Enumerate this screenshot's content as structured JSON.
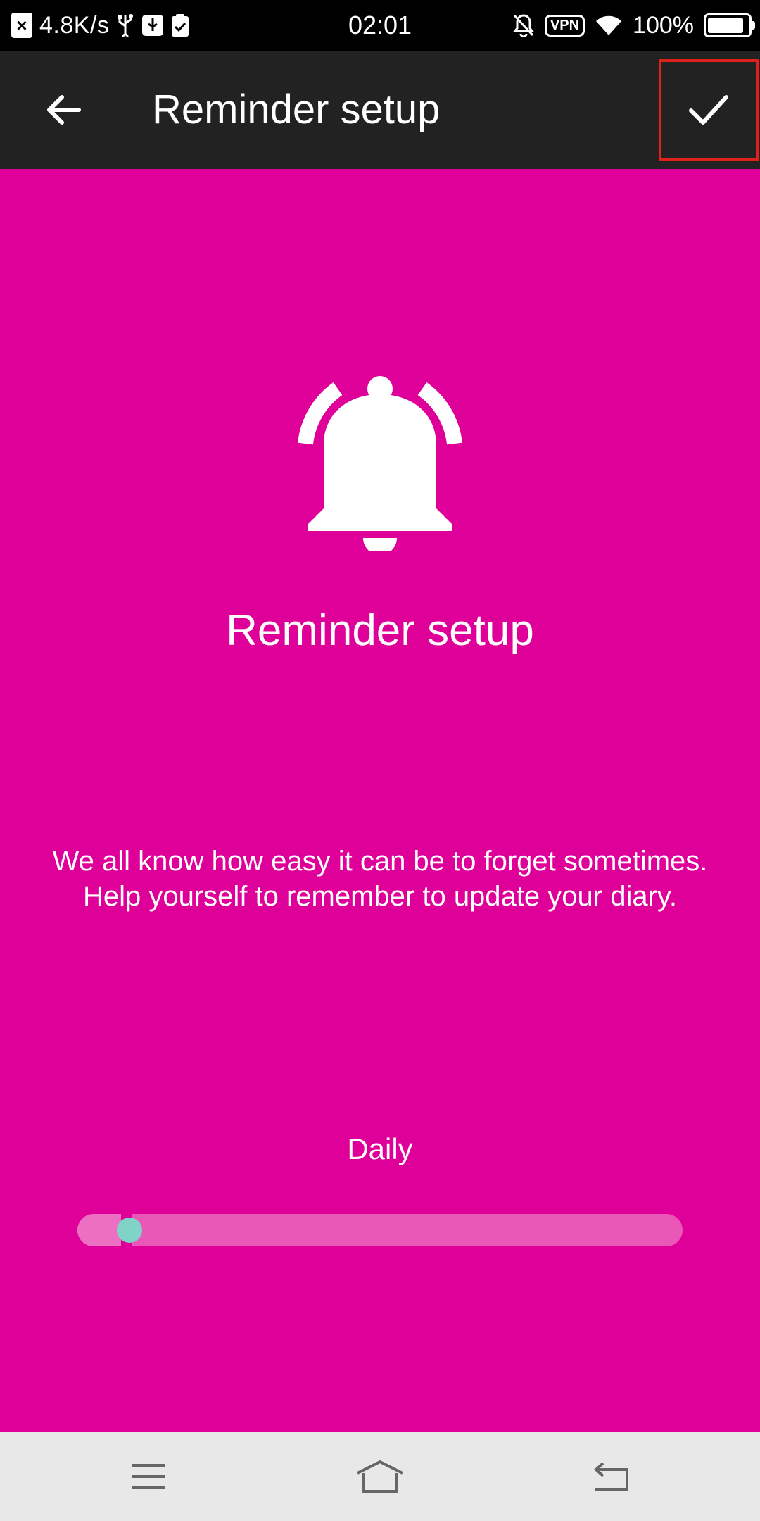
{
  "status_bar": {
    "net_speed": "4.8K/s",
    "time": "02:01",
    "vpn": "VPN",
    "battery_pct": "100%",
    "battery_level": 1.0
  },
  "app_bar": {
    "title": "Reminder setup",
    "back_icon": "arrow-left-icon",
    "confirm_icon": "check-icon"
  },
  "main": {
    "icon": "bell-ringing-icon",
    "heading": "Reminder setup",
    "description": "We all know how easy it can be to forget sometimes. Help yourself to remember to update your diary.",
    "frequency": {
      "label": "Daily",
      "value_fraction": 0.1
    }
  },
  "nav_bar": {
    "menu_icon": "menu-icon",
    "home_icon": "home-icon",
    "back_icon": "back-icon"
  },
  "colors": {
    "accent": "#de0098",
    "app_bar": "#222222",
    "slider_thumb": "#7fd3c7",
    "highlight": "#e0201a"
  }
}
